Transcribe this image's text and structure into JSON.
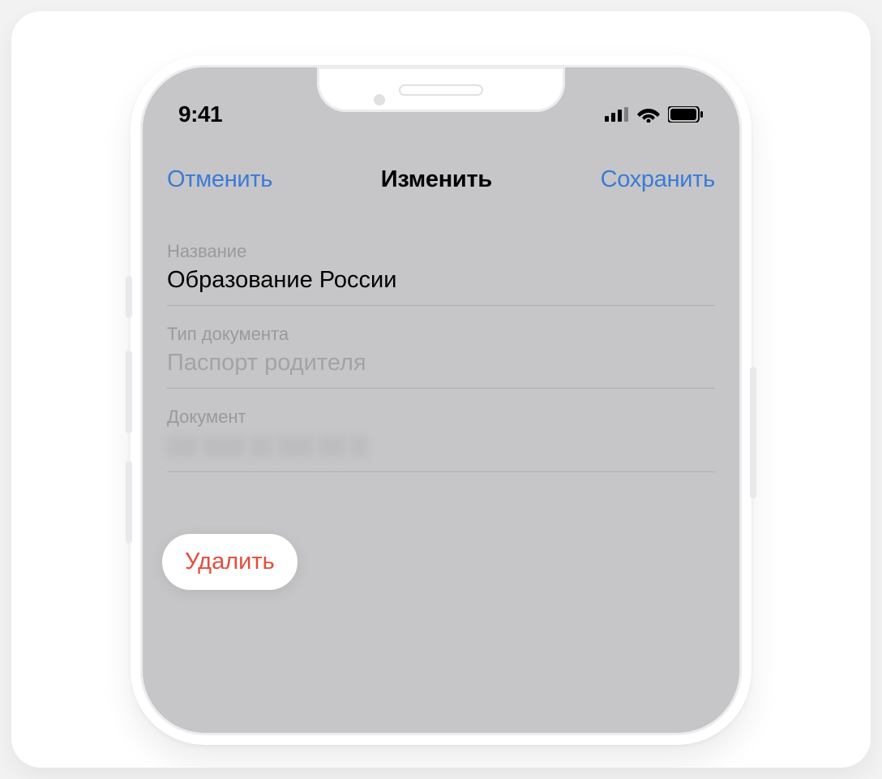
{
  "statusBar": {
    "time": "9:41"
  },
  "nav": {
    "cancel": "Отменить",
    "title": "Изменить",
    "save": "Сохранить"
  },
  "fields": {
    "nameLabel": "Название",
    "nameValue": "Образование России",
    "docTypeLabel": "Тип документа",
    "docTypeValue": "Паспорт родителя",
    "docLabel": "Документ"
  },
  "actions": {
    "delete": "Удалить"
  }
}
